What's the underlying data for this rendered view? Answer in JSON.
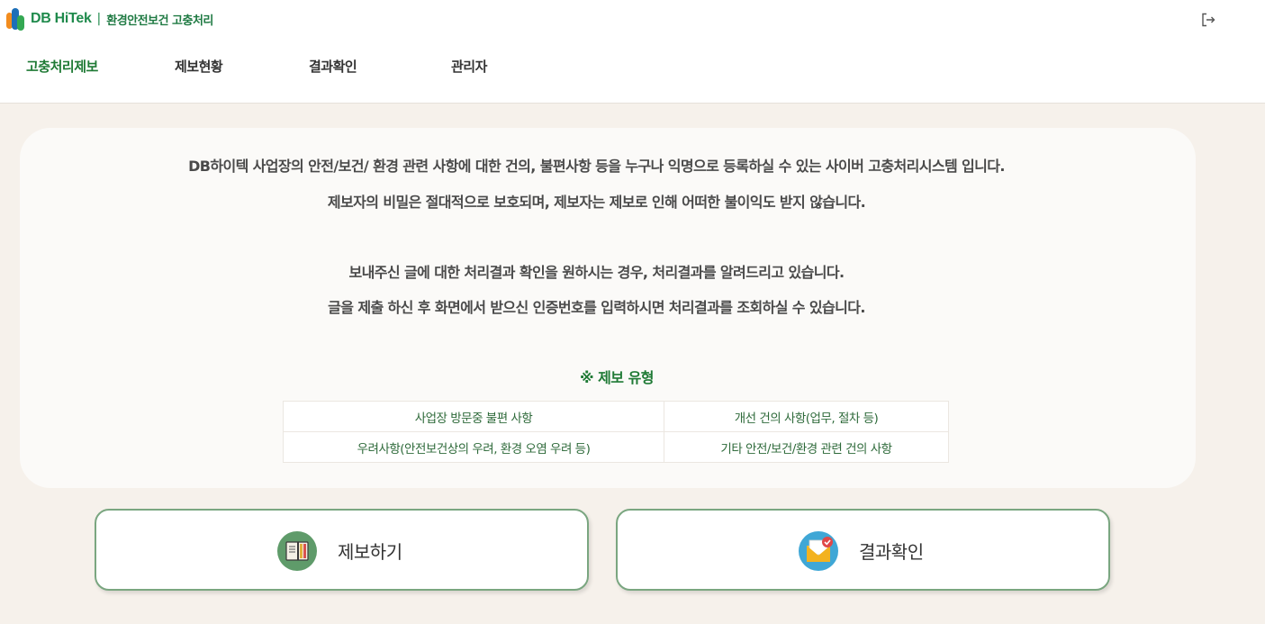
{
  "brand": {
    "name": "DB HiTek",
    "separator": "|",
    "subtitle": "환경안전보건 고충처리"
  },
  "header": {
    "logout_icon": "logout-icon"
  },
  "nav": {
    "items": [
      {
        "label": "고충처리제보",
        "active": true
      },
      {
        "label": "제보현황",
        "active": false
      },
      {
        "label": "결과확인",
        "active": false
      },
      {
        "label": "관리자",
        "active": false
      }
    ]
  },
  "intro": {
    "line1": "DB하이텍 사업장의 안전/보건/ 환경 관련 사항에 대한 건의, 불편사항 등을 누구나 익명으로 등록하실 수 있는 사이버 고충처리시스템 입니다.",
    "line2": "제보자의 비밀은 절대적으로 보호되며, 제보자는 제보로 인해 어떠한 불이익도 받지 않습니다.",
    "line3": "보내주신 글에 대한 처리결과 확인을 원하시는 경우, 처리결과를 알려드리고 있습니다.",
    "line4": "글을 제출 하신 후 화면에서 받으신 인증번호를 입력하시면 처리결과를 조회하실 수 있습니다."
  },
  "report_types": {
    "title": "※ 제보 유형",
    "rows": [
      [
        "사업장 방문중 불편 사항",
        "개선 건의 사항(업무, 절차 등)"
      ],
      [
        "우려사항(안전보건상의 우려, 환경 오염 우려 등)",
        "기타 안전/보건/환경 관련 건의 사항"
      ]
    ]
  },
  "actions": {
    "report_label": "제보하기",
    "report_icon": "notebook-icon",
    "result_label": "결과확인",
    "result_icon": "envelope-check-icon"
  },
  "colors": {
    "accent_green": "#1f7a35",
    "background": "#f6f1eb",
    "button_border": "#7aa680"
  }
}
